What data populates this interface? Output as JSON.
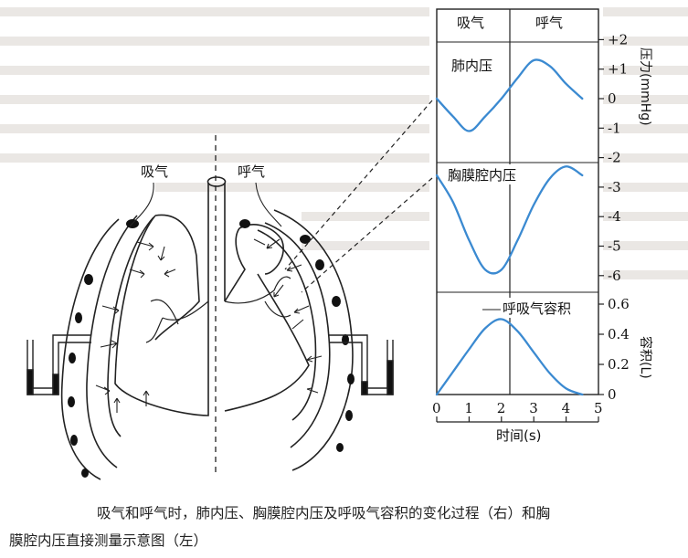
{
  "figure": {
    "left": {
      "label_inhale": "吸气",
      "label_exhale": "呼气"
    },
    "right": {
      "header_inhale": "吸气",
      "header_exhale": "呼气",
      "panel_lung_pressure": "肺内压",
      "panel_pleural_pressure": "胸膜腔内压",
      "panel_volume": "呼吸气容积",
      "y_axis_pressure": "压力(mmHg)",
      "y_axis_volume": "容积(L)",
      "x_axis_label": "时间(s)",
      "pressure_ticks_lung": [
        "+2",
        "+1",
        "0",
        "-1"
      ],
      "pressure_ticks_pleural": [
        "-2",
        "-3",
        "-4",
        "-5",
        "-6"
      ],
      "volume_ticks": [
        "0.6",
        "0.4",
        "0.2",
        "0"
      ],
      "time_ticks": [
        "0",
        "1",
        "2",
        "3",
        "4",
        "5"
      ]
    }
  },
  "chart_data": [
    {
      "type": "line",
      "title": "肺内压",
      "ylabel": "压力(mmHg)",
      "xlabel": "时间(s)",
      "ylim": [
        -1.5,
        2.3
      ],
      "xlim": [
        0,
        5
      ],
      "x": [
        0,
        0.5,
        1,
        1.5,
        2,
        2.5,
        3,
        3.5,
        4,
        4.5
      ],
      "values": [
        0,
        -0.6,
        -1.1,
        -0.6,
        0,
        0.7,
        1.3,
        1.1,
        0.5,
        0
      ]
    },
    {
      "type": "line",
      "title": "胸膜腔内压",
      "ylabel": "压力(mmHg)",
      "xlabel": "时间(s)",
      "ylim": [
        -6.3,
        -2
      ],
      "xlim": [
        0,
        5
      ],
      "x": [
        0,
        0.5,
        1,
        1.5,
        2,
        2.5,
        3,
        3.5,
        4,
        4.5
      ],
      "values": [
        -2.6,
        -3.5,
        -4.8,
        -5.8,
        -5.8,
        -4.8,
        -3.6,
        -2.7,
        -2.3,
        -2.6
      ]
    },
    {
      "type": "line",
      "title": "呼吸气容积",
      "ylabel": "容积(L)",
      "xlabel": "时间(s)",
      "ylim": [
        0,
        0.6
      ],
      "xlim": [
        0,
        5
      ],
      "x": [
        0,
        0.5,
        1,
        1.5,
        2,
        2.5,
        3,
        3.5,
        4,
        4.5
      ],
      "values": [
        0,
        0.15,
        0.3,
        0.44,
        0.5,
        0.42,
        0.28,
        0.14,
        0.04,
        0
      ]
    }
  ],
  "caption": {
    "line1": "吸气和呼气时，肺内压、胸膜腔内压及呼吸气容积的变化过程（右）和胸",
    "line2": "膜腔内压直接测量示意图（左）"
  }
}
